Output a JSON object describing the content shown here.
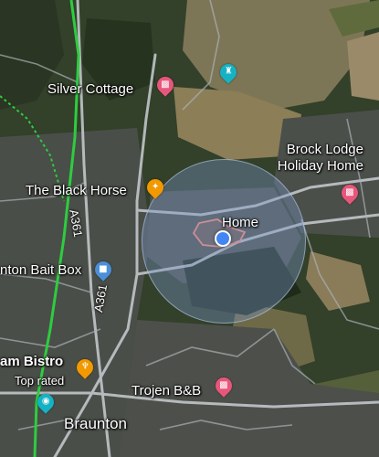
{
  "map": {
    "places": [
      {
        "name": "Silver Cottage",
        "type": "lodging"
      },
      {
        "name": "The Black Horse",
        "type": "bar"
      },
      {
        "name": "Brock Lodge\nHoliday Home",
        "type": "lodging"
      },
      {
        "name": "Home",
        "type": "home"
      },
      {
        "name": "nton Bait Box",
        "type": "shop"
      },
      {
        "name": "am Bistro",
        "type": "restaurant"
      },
      {
        "name": "Trojen B&B",
        "type": "lodging"
      },
      {
        "name": "Braunton",
        "type": "town"
      }
    ],
    "bistro_badge": "Top rated",
    "road_label_1": "A361",
    "road_label_2": "A361",
    "icons": {
      "lodging": "bed-icon",
      "bar": "cocktail-icon",
      "shop": "shopping-bag-icon",
      "restaurant": "fork-knife-icon",
      "attraction": "castle-icon",
      "camera": "camera-icon"
    },
    "colors": {
      "lodging_pin": "#e8567c",
      "bar_pin": "#f29900",
      "shop_pin": "#4a8fd8",
      "attraction_pin": "#15b2c4",
      "location_dot": "#4285f4",
      "route_green": "#2ecc40",
      "home_outline": "#ff8a7a"
    }
  }
}
